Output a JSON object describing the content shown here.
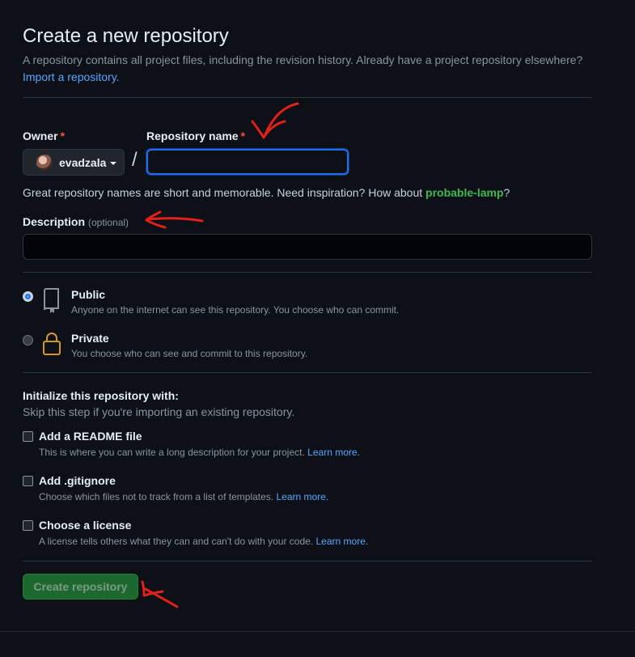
{
  "header": {
    "title": "Create a new repository",
    "subtitle": "A repository contains all project files, including the revision history. Already have a project repository elsewhere?",
    "import_link": "Import a repository."
  },
  "owner": {
    "label": "Owner",
    "required_mark": "*",
    "name": "evadzala"
  },
  "separator": "/",
  "repo_name": {
    "label": "Repository name",
    "required_mark": "*",
    "value": ""
  },
  "hint": {
    "text": "Great repository names are short and memorable. Need inspiration? How about ",
    "suggestion": "probable-lamp",
    "end": "?"
  },
  "description": {
    "label": "Description",
    "optional": "(optional)",
    "value": ""
  },
  "visibility": [
    {
      "title": "Public",
      "desc": "Anyone on the internet can see this repository. You choose who can commit.",
      "selected": true,
      "icon": "repo-icon"
    },
    {
      "title": "Private",
      "desc": "You choose who can see and commit to this repository.",
      "selected": false,
      "icon": "lock-icon"
    }
  ],
  "initialize": {
    "title": "Initialize this repository with:",
    "subtitle": "Skip this step if you're importing an existing repository.",
    "options": [
      {
        "title": "Add a README file",
        "desc": "This is where you can write a long description for your project.",
        "link": "Learn more.",
        "checked": false
      },
      {
        "title": "Add .gitignore",
        "desc": "Choose which files not to track from a list of templates.",
        "link": "Learn more.",
        "checked": false
      },
      {
        "title": "Choose a license",
        "desc": "A license tells others what they can and can't do with your code.",
        "link": "Learn more.",
        "checked": false
      }
    ]
  },
  "submit": {
    "label": "Create repository"
  },
  "colors": {
    "background": "#0d1117",
    "link": "#58a6ff",
    "required": "#f85149",
    "suggestion": "#3fb950",
    "button": "#238636",
    "annotation": "#e0201a",
    "private_lock": "#d29922"
  }
}
